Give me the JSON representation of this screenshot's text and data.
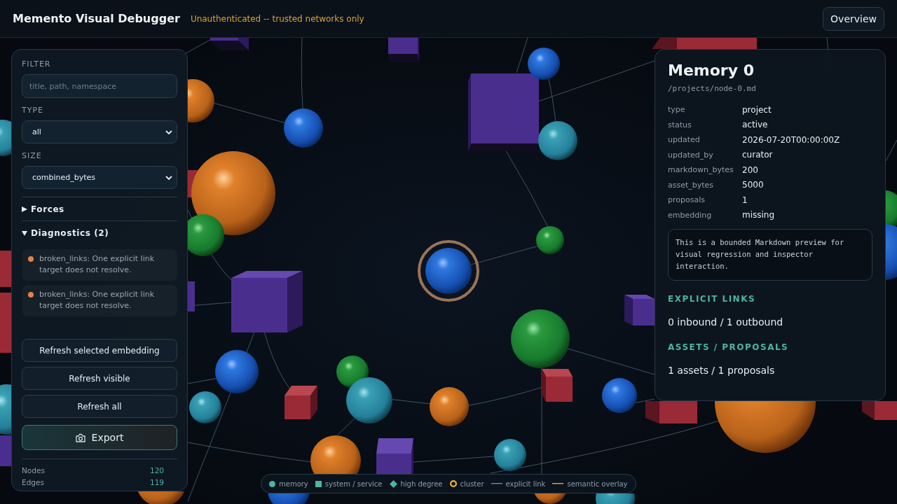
{
  "header": {
    "title": "Memento Visual Debugger",
    "notice": "Unauthenticated -- trusted networks only",
    "button": "Overview"
  },
  "controls": {
    "fields": [
      {
        "kind": "text",
        "label": "FILTER",
        "placeholder": "title, path, namespace"
      },
      {
        "kind": "select",
        "label": "TYPE",
        "value": "all"
      },
      {
        "kind": "select",
        "label": "SIZE",
        "value": "combined_bytes"
      }
    ],
    "sections": [
      {
        "title": "Forces",
        "expanded": false
      },
      {
        "title": "Diagnostics (2)",
        "expanded": true,
        "items": [
          {
            "text": "broken_links: One explicit link target does not resolve.",
            "color": "#e8804a"
          },
          {
            "text": "broken_links: One explicit link target does not resolve.",
            "color": "#e8804a"
          }
        ]
      }
    ],
    "actions": [
      "Refresh selected embedding",
      "Refresh visible",
      "Refresh all"
    ],
    "export": "Export",
    "stats": [
      {
        "label": "Nodes",
        "value": "120"
      },
      {
        "label": "Edges",
        "value": "119"
      }
    ]
  },
  "inspector": {
    "title": "Memory 0",
    "path": "/projects/node-0.md",
    "fields": [
      {
        "key": "type",
        "value": "project"
      },
      {
        "key": "status",
        "value": "active"
      },
      {
        "key": "updated",
        "value": "2026-07-20T00:00:00Z"
      },
      {
        "key": "updated_by",
        "value": "curator"
      },
      {
        "key": "markdown_bytes",
        "value": "200"
      },
      {
        "key": "asset_bytes",
        "value": "5000"
      },
      {
        "key": "proposals",
        "value": "1"
      },
      {
        "key": "embedding",
        "value": "missing"
      }
    ],
    "preview": "This is a bounded Markdown preview for visual regression and inspector interaction.",
    "sections": [
      {
        "heading": "EXPLICIT LINKS",
        "text": "0 inbound / 1 outbound"
      },
      {
        "heading": "ASSETS / PROPOSALS",
        "text": "1 assets / 1 proposals"
      }
    ]
  },
  "legend": {
    "items": [
      {
        "label": "memory",
        "kind": "circle",
        "color": "#4fb3a0"
      },
      {
        "label": "system / service",
        "kind": "square",
        "color": "#4fb3a0"
      },
      {
        "label": "high degree",
        "kind": "diamond",
        "color": "#4fb3a0"
      },
      {
        "label": "cluster",
        "kind": "ring",
        "color": "#f0b429"
      },
      {
        "label": "explicit link",
        "kind": "line",
        "color": "#6b8aa0"
      },
      {
        "label": "semantic overlay",
        "kind": "line",
        "color": "#e0a838"
      }
    ]
  }
}
